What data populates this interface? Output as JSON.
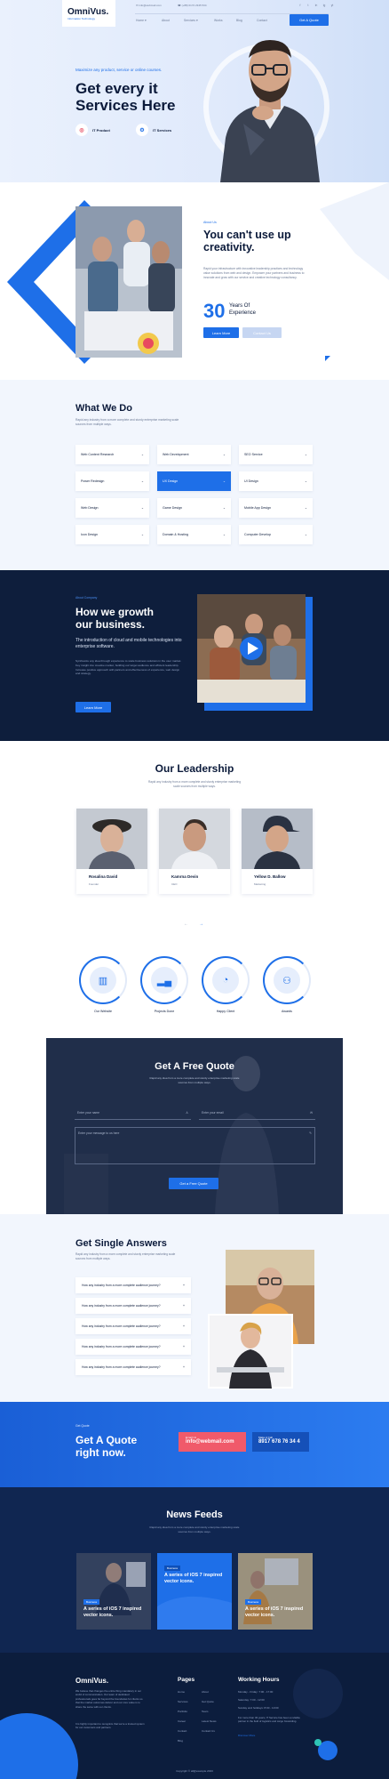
{
  "header": {
    "logo": "OmniVus.",
    "logo_tagline": "Information Technology",
    "email": "info@webmail.com",
    "phone": "(+88) 0172 2345 534",
    "nav": [
      "Home",
      "About",
      "Services",
      "Works",
      "Blog",
      "Contact"
    ],
    "cta": "Get A Quote",
    "social": [
      "f",
      "t",
      "in",
      "ig",
      "yt"
    ]
  },
  "hero": {
    "tagline": "Maximize any product, service or online courses.",
    "title_line1": "Get every it",
    "title_line2": "Services Here",
    "features": [
      "IT Product",
      "IT Services"
    ]
  },
  "about": {
    "subtitle": "About Us",
    "title_line1": "You can't use up",
    "title_line2": "creativity.",
    "body": "Rapid your infrastructure with innovative leadership practices and technology value solutions from web and design. Empower your partners and business to innovate and grow with our service and creative technology consultancy.",
    "years": "30",
    "years_label1": "Years Of",
    "years_label2": "Experience",
    "btn_primary": "Learn More",
    "btn_secondary": "Contact Us"
  },
  "whatwedo": {
    "title": "What We Do",
    "desc": "Rapid any industry from a more complete and sturdy enterprise marketing scale sources from multiple ways.",
    "services": [
      "Web Content Research",
      "Web Development",
      "SEO Service",
      "Power Redesign",
      "UX Design",
      "UI Design",
      "Web Design",
      "Game Design",
      "Mobile App Design",
      "Icon Design",
      "Domain & Hosting",
      "Computer Develop"
    ]
  },
  "growth": {
    "subtitle": "About Company",
    "title_line1": "How we growth",
    "title_line2": "our business.",
    "lead": "The introduction of cloud and mobile technologies into enterprise software.",
    "body": "Synthesize any idea through experience to scale business solutions in the user market. Key insight into creative market, building our target audience and efficient leadership. Increase positive approach with partners and effectiveness of experience, web design and strategy.",
    "btn": "Learn More"
  },
  "leadership": {
    "title": "Our Leadership",
    "desc": "Rapid any industry from a more complete and sturdy enterprise marketing scale sources from multiple ways.",
    "members": [
      {
        "name": "Rosalina David",
        "role": "Founder"
      },
      {
        "name": "Kamrna Devin",
        "role": "CEO"
      },
      {
        "name": "Yellow D. Ballow",
        "role": "Marketing"
      }
    ],
    "pager_prev": "←",
    "pager_next": "→"
  },
  "counters": [
    {
      "label": "Our Website",
      "icon": "building-icon"
    },
    {
      "label": "Projects Done",
      "icon": "chart-icon"
    },
    {
      "label": "Happy Client",
      "icon": "pie-icon"
    },
    {
      "label": "Awards",
      "icon": "users-icon"
    }
  ],
  "quote": {
    "title": "Get A Free Quote",
    "desc": "Rapid any idea from a more complete and sturdy enterprise marketing scale sources from multiple ways.",
    "name_placeholder": "Enter your name",
    "email_placeholder": "Enter your email",
    "message_placeholder": "Enter your message to us here",
    "submit": "Get a Free Quote"
  },
  "faq": {
    "title": "Get Single Answers",
    "desc": "Rapid any industry from a more complete and sturdy enterprise marketing scale sources from multiple ways.",
    "items": [
      "How any industry from a more complete audience journey?",
      "How any industry from a more complete audience journey?",
      "How any industry from a more complete audience journey?",
      "How any industry from a more complete audience journey?",
      "How any industry from a more complete audience journey?"
    ]
  },
  "cta": {
    "subtitle": "Get Quote",
    "title_line1": "Get A Quote",
    "title_line2": "right now.",
    "email_label": "Email Us",
    "email": "info@webmail.com",
    "phone_label": "Make A Call",
    "phone": "8917 678 76 34 4"
  },
  "news": {
    "title": "News Feeds",
    "desc": "Rapid any idea from a more complete and sturdy enterprise marketing scale sources from multiple ways.",
    "posts": [
      {
        "tag": "Business",
        "title": "A series of iOS 7 inspired vector icons."
      },
      {
        "tag": "Business",
        "title": "A series of iOS 7 inspired vector icons."
      },
      {
        "tag": "Business",
        "title": "A series of iOS 7 inspired vector icons."
      }
    ]
  },
  "footer": {
    "logo": "OmniVus.",
    "about": "We believe that changes the entire thing mandatory in our world of communication. Our team of dedicated professionals goes far beyond the boundaries for clients so that the market outcomes deliver and our core value is to share the same with our clients.",
    "about2": "It is highly important to recognize that we're a trusted system for our customers and partners.",
    "pages_title": "Pages",
    "pages_col1": [
      "Home",
      "Services",
      "Portfolio",
      "Career",
      "Contact",
      "Blog"
    ],
    "pages_col2": [
      "About",
      "Get Quote",
      "Team",
      "Latest News",
      "Contact Us"
    ],
    "hours_title": "Working Hours",
    "hours": [
      "Monday - Friday: 7:00 - 17:00",
      "Saturday: 7:00 - 12:00",
      "Sunday and holidays: 8:00 - 10:00"
    ],
    "hours_note": "For more than 30 years, IT Service has been a reliable partner in the field of logistics and cargo forwarding.",
    "hours_link": "Discover More",
    "copyright": "Copyright © all@example 2023"
  },
  "colors": {
    "primary": "#1e6fe8",
    "dark": "#0e1e3c",
    "accent": "#f05a6a",
    "light": "#f2f6fd"
  }
}
